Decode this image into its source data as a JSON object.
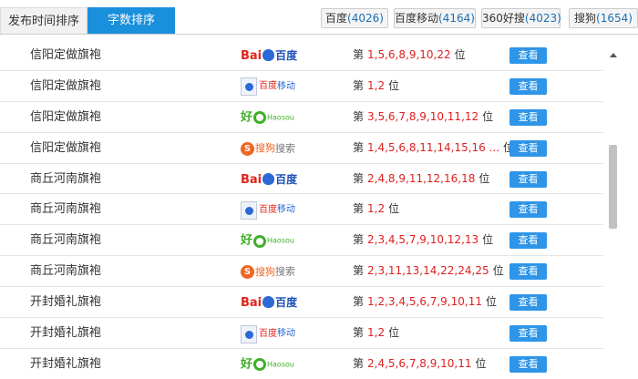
{
  "tabs": {
    "time_label": "发布时间排序",
    "count_label": "字数排序"
  },
  "engines": [
    {
      "name": "百度",
      "count": "(4026)"
    },
    {
      "name": "百度移动",
      "count": "(4164)"
    },
    {
      "name": "360好搜",
      "count": "(4023)"
    },
    {
      "name": "搜狗",
      "count": "(1654)"
    }
  ],
  "logos": {
    "baidu": {
      "bai": "Bai",
      "du": "du",
      "cn": "百度"
    },
    "mobile": {
      "a": "百度",
      "b": "移动"
    },
    "haosou": {
      "hao": "好",
      "en": "Haosou"
    },
    "sogou": {
      "s": "S",
      "a": "搜狗",
      "b": "搜索"
    }
  },
  "rank_prefix": "第",
  "rank_suffix": "位",
  "view_label": "查看",
  "rows": [
    {
      "keyword": "信阳定做旗袍",
      "engine": "baidu",
      "ranks": "1,5,6,8,9,10,22"
    },
    {
      "keyword": "信阳定做旗袍",
      "engine": "mobile",
      "ranks": "1,2"
    },
    {
      "keyword": "信阳定做旗袍",
      "engine": "haosou",
      "ranks": "3,5,6,7,8,9,10,11,12"
    },
    {
      "keyword": "信阳定做旗袍",
      "engine": "sogou",
      "ranks": "1,4,5,6,8,11,14,15,16 ..."
    },
    {
      "keyword": "商丘河南旗袍",
      "engine": "baidu",
      "ranks": "2,4,8,9,11,12,16,18"
    },
    {
      "keyword": "商丘河南旗袍",
      "engine": "mobile",
      "ranks": "1,2"
    },
    {
      "keyword": "商丘河南旗袍",
      "engine": "haosou",
      "ranks": "2,3,4,5,7,9,10,12,13"
    },
    {
      "keyword": "商丘河南旗袍",
      "engine": "sogou",
      "ranks": "2,3,11,13,14,22,24,25"
    },
    {
      "keyword": "开封婚礼旗袍",
      "engine": "baidu",
      "ranks": "1,2,3,4,5,6,7,9,10,11"
    },
    {
      "keyword": "开封婚礼旗袍",
      "engine": "mobile",
      "ranks": "1,2"
    },
    {
      "keyword": "开封婚礼旗袍",
      "engine": "haosou",
      "ranks": "2,4,5,6,7,8,9,10,11"
    }
  ]
}
